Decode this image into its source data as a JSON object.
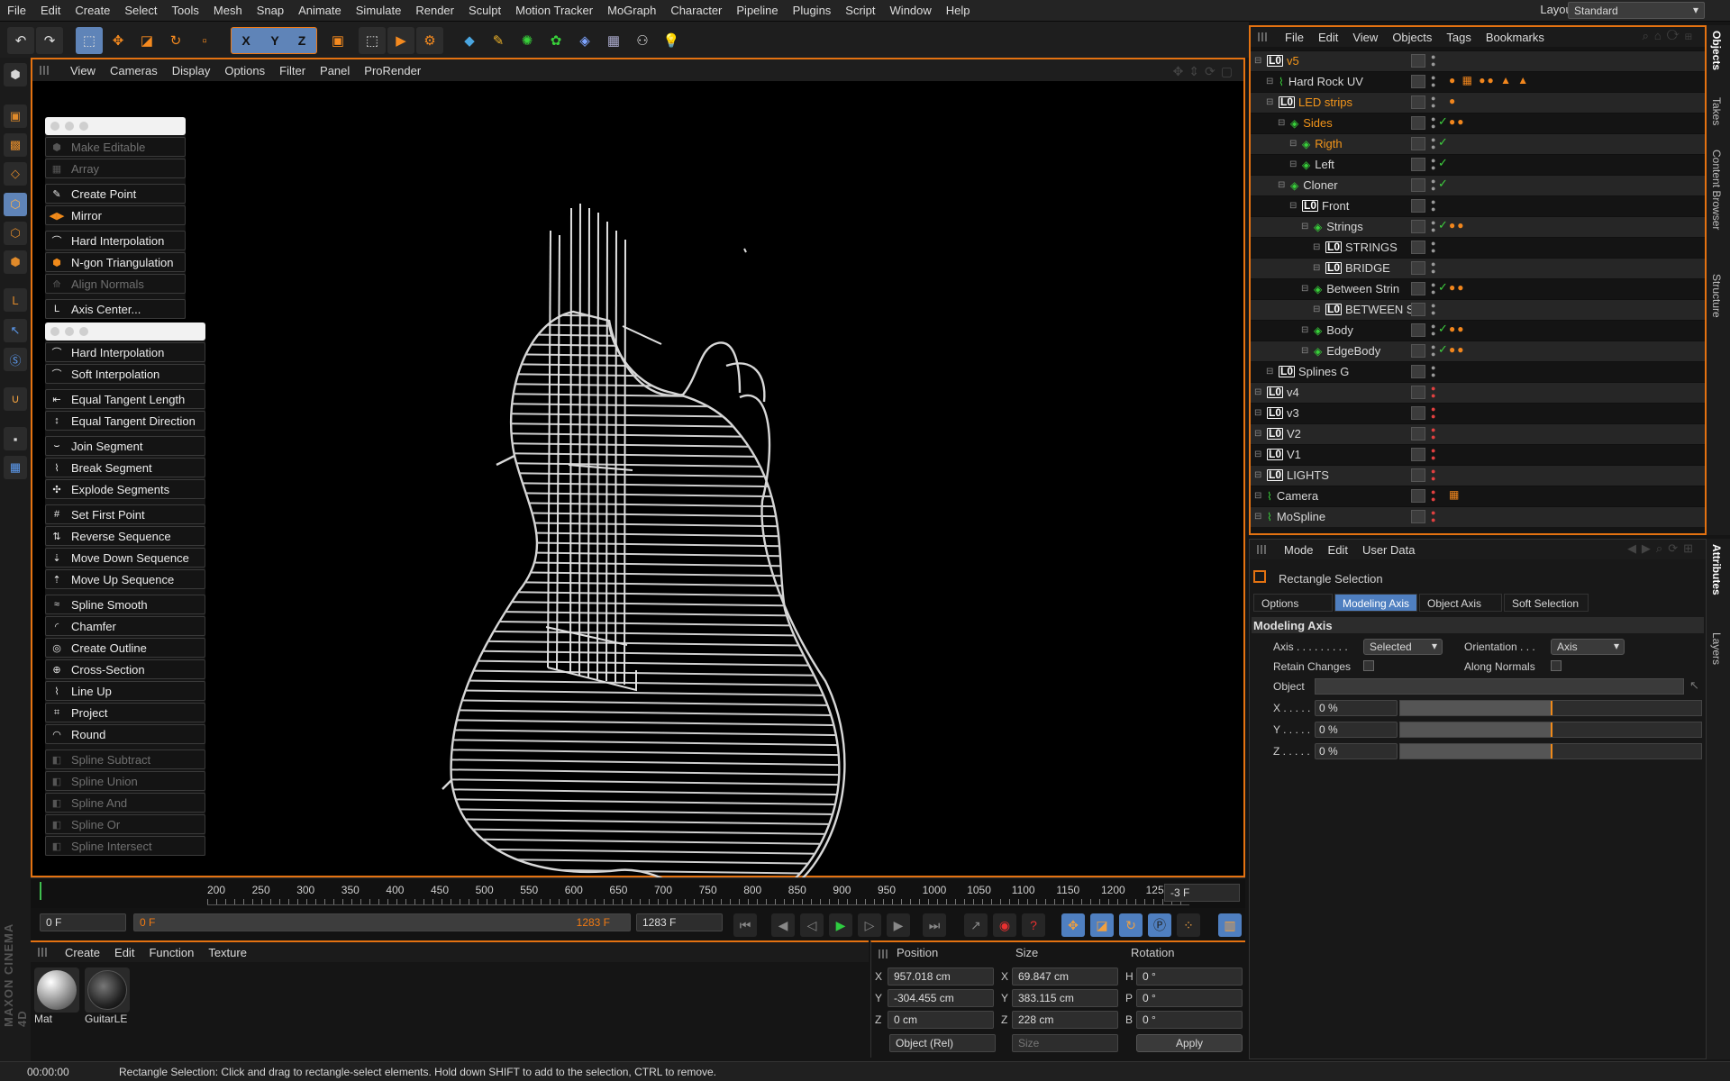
{
  "menu": [
    "File",
    "Edit",
    "Create",
    "Select",
    "Tools",
    "Mesh",
    "Snap",
    "Animate",
    "Simulate",
    "Render",
    "Sculpt",
    "Motion Tracker",
    "MoGraph",
    "Character",
    "Pipeline",
    "Plugins",
    "Script",
    "Window",
    "Help"
  ],
  "layout": {
    "label": "Layout:",
    "value": "Standard"
  },
  "toolbar": {
    "x": "X",
    "y": "Y",
    "z": "Z"
  },
  "viewport": {
    "menu": [
      "View",
      "Cameras",
      "Display",
      "Options",
      "Filter",
      "Panel",
      "ProRender"
    ]
  },
  "cmd_panel1": [
    {
      "label": "Make Editable",
      "icon": "make-editable-icon",
      "disabled": true
    },
    {
      "label": "Array",
      "icon": "array-icon",
      "disabled": true
    },
    {
      "label": "Create Point",
      "icon": "create-point-icon",
      "disabled": false
    },
    {
      "label": "Mirror",
      "icon": "mirror-icon",
      "disabled": false
    },
    {
      "label": "Hard Interpolation",
      "icon": "hard-interpolation-icon",
      "disabled": false
    },
    {
      "label": "N-gon Triangulation",
      "icon": "ngon-triangulation-icon",
      "disabled": false
    },
    {
      "label": "Align Normals",
      "icon": "align-normals-icon",
      "disabled": true
    },
    {
      "label": "Axis Center...",
      "icon": "axis-center-icon",
      "disabled": false
    }
  ],
  "cmd_panel2": [
    {
      "label": "Hard Interpolation",
      "gap": false,
      "disabled": false
    },
    {
      "label": "Soft Interpolation",
      "gap": false,
      "disabled": false
    },
    {
      "label": "Equal Tangent Length",
      "gap": true,
      "disabled": false
    },
    {
      "label": "Equal Tangent Direction",
      "gap": false,
      "disabled": false
    },
    {
      "label": "Join Segment",
      "gap": true,
      "disabled": false
    },
    {
      "label": "Break Segment",
      "gap": false,
      "disabled": false
    },
    {
      "label": "Explode Segments",
      "gap": false,
      "disabled": false
    },
    {
      "label": "Set First Point",
      "gap": true,
      "disabled": false
    },
    {
      "label": "Reverse Sequence",
      "gap": false,
      "disabled": false
    },
    {
      "label": "Move Down Sequence",
      "gap": false,
      "disabled": false
    },
    {
      "label": "Move Up Sequence",
      "gap": false,
      "disabled": false
    },
    {
      "label": "Spline Smooth",
      "gap": true,
      "disabled": false
    },
    {
      "label": "Chamfer",
      "gap": false,
      "disabled": false
    },
    {
      "label": "Create Outline",
      "gap": false,
      "disabled": false
    },
    {
      "label": "Cross-Section",
      "gap": false,
      "disabled": false
    },
    {
      "label": "Line Up",
      "gap": false,
      "disabled": false
    },
    {
      "label": "Project",
      "gap": false,
      "disabled": false
    },
    {
      "label": "Round",
      "gap": false,
      "disabled": false
    },
    {
      "label": "Spline Subtract",
      "gap": true,
      "disabled": true
    },
    {
      "label": "Spline Union",
      "gap": false,
      "disabled": true
    },
    {
      "label": "Spline And",
      "gap": false,
      "disabled": true
    },
    {
      "label": "Spline Or",
      "gap": false,
      "disabled": true
    },
    {
      "label": "Spline Intersect",
      "gap": false,
      "disabled": true
    }
  ],
  "timeline": {
    "ticks": [
      "200",
      "250",
      "300",
      "350",
      "400",
      "450",
      "500",
      "550",
      "600",
      "650",
      "700",
      "750",
      "800",
      "850",
      "900",
      "950",
      "1000",
      "1050",
      "1100",
      "1150",
      "1200",
      "1250"
    ],
    "current": "-3 F"
  },
  "transport": {
    "start": "0 F",
    "range_start": "0 F",
    "range_end": "1283 F",
    "end": "1283 F"
  },
  "materials": {
    "menu": [
      "Create",
      "Edit",
      "Function",
      "Texture"
    ],
    "items": [
      "Mat",
      "GuitarLE"
    ]
  },
  "coords": {
    "headers": [
      "Position",
      "Size",
      "Rotation"
    ],
    "axes": [
      "X",
      "Y",
      "Z"
    ],
    "rot_axes": [
      "H",
      "P",
      "B"
    ],
    "position": [
      "957.018 cm",
      "-304.455 cm",
      "0 cm"
    ],
    "size": [
      "69.847 cm",
      "383.115 cm",
      "228 cm"
    ],
    "rotation": [
      "0 °",
      "0 °",
      "0 °"
    ],
    "mode": "Object (Rel)",
    "size_mode": "Size",
    "apply": "Apply"
  },
  "status": {
    "time": "00:00:00",
    "message": "Rectangle Selection: Click and drag to rectangle-select elements. Hold down SHIFT to add to the selection, CTRL to remove."
  },
  "objects": {
    "menu": [
      "File",
      "Edit",
      "View",
      "Objects",
      "Tags",
      "Bookmarks"
    ],
    "rows": [
      {
        "name": "v5",
        "indent": 0,
        "null": true,
        "orange": true,
        "gray": true,
        "check": false,
        "tags": ""
      },
      {
        "name": "Hard Rock UV",
        "indent": 1,
        "null": false,
        "orange": false,
        "gray": false,
        "check": false,
        "tags": "● ▦ ●● ▲ ▲"
      },
      {
        "name": "LED strips",
        "indent": 1,
        "null": true,
        "orange": true,
        "gray": true,
        "check": false,
        "tags": "●"
      },
      {
        "name": "Sides",
        "indent": 2,
        "null": false,
        "orange": true,
        "gray": false,
        "check": true,
        "tags": "●●"
      },
      {
        "name": "Rigth",
        "indent": 3,
        "null": false,
        "orange": true,
        "gray": true,
        "check": true,
        "tags": ""
      },
      {
        "name": "Left",
        "indent": 3,
        "null": false,
        "orange": false,
        "gray": false,
        "check": true,
        "tags": ""
      },
      {
        "name": "Cloner",
        "indent": 2,
        "null": false,
        "orange": false,
        "gray": true,
        "check": true,
        "tags": ""
      },
      {
        "name": "Front",
        "indent": 3,
        "null": true,
        "orange": false,
        "gray": false,
        "check": false,
        "tags": ""
      },
      {
        "name": "Strings",
        "indent": 4,
        "null": false,
        "orange": false,
        "gray": true,
        "check": true,
        "tags": "●●"
      },
      {
        "name": "STRINGS",
        "indent": 5,
        "null": true,
        "orange": false,
        "gray": false,
        "check": false,
        "tags": ""
      },
      {
        "name": "BRIDGE",
        "indent": 5,
        "null": true,
        "orange": false,
        "gray": true,
        "check": false,
        "tags": ""
      },
      {
        "name": "Between Strin",
        "indent": 4,
        "null": false,
        "orange": false,
        "gray": false,
        "check": true,
        "tags": "●●"
      },
      {
        "name": "BETWEEN S",
        "indent": 5,
        "null": true,
        "orange": false,
        "gray": true,
        "check": false,
        "tags": ""
      },
      {
        "name": "Body",
        "indent": 4,
        "null": false,
        "orange": false,
        "gray": false,
        "check": true,
        "tags": "●●"
      },
      {
        "name": "EdgeBody",
        "indent": 4,
        "null": false,
        "orange": false,
        "gray": true,
        "check": true,
        "tags": "●●"
      },
      {
        "name": "Splines G",
        "indent": 1,
        "null": true,
        "orange": false,
        "gray": false,
        "check": false,
        "tags": ""
      },
      {
        "name": "v4",
        "indent": 0,
        "null": true,
        "orange": false,
        "gray": true,
        "check": false,
        "tags": ""
      },
      {
        "name": "v3",
        "indent": 0,
        "null": true,
        "orange": false,
        "gray": false,
        "check": false,
        "tags": ""
      },
      {
        "name": "V2",
        "indent": 0,
        "null": true,
        "orange": false,
        "gray": true,
        "check": false,
        "tags": ""
      },
      {
        "name": "V1",
        "indent": 0,
        "null": true,
        "orange": false,
        "gray": false,
        "check": false,
        "tags": ""
      },
      {
        "name": "LIGHTS",
        "indent": 0,
        "null": true,
        "orange": false,
        "gray": true,
        "check": false,
        "tags": ""
      },
      {
        "name": "Camera",
        "indent": 0,
        "null": false,
        "orange": false,
        "gray": false,
        "check": false,
        "tags": "▦"
      },
      {
        "name": "MoSpline",
        "indent": 0,
        "null": false,
        "orange": false,
        "gray": true,
        "check": false,
        "tags": ""
      }
    ]
  },
  "side_tabs_top": [
    "Objects",
    "Takes",
    "Content Browser",
    "Structure"
  ],
  "side_tabs_bottom": [
    "Attributes",
    "Layers"
  ],
  "attributes": {
    "menu": [
      "Mode",
      "Edit",
      "User Data"
    ],
    "tool": "Rectangle Selection",
    "tabs": [
      "Options",
      "Modeling Axis",
      "Object Axis",
      "Soft Selection"
    ],
    "section": "Modeling Axis",
    "axis_label": "Axis . . . . . . . . .",
    "axis_value": "Selected",
    "orientation_label": "Orientation . . .",
    "orientation_value": "Axis",
    "retain_changes": "Retain Changes",
    "along_normals": "Along Normals",
    "object_label": "Object",
    "xyz": [
      {
        "label": "X . . . . .",
        "value": "0 %",
        "level": 0.5
      },
      {
        "label": "Y . . . . .",
        "value": "0 %",
        "level": 0.5
      },
      {
        "label": "Z . . . . .",
        "value": "0 %",
        "level": 0.5
      }
    ]
  }
}
